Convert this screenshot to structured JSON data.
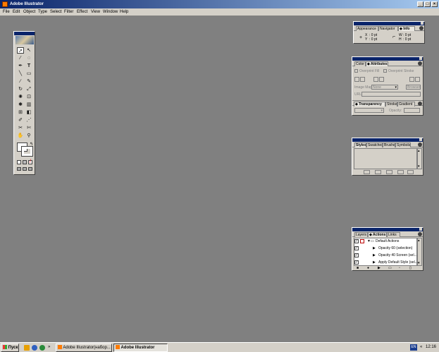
{
  "window": {
    "title": "Adobe Illustrator"
  },
  "window_buttons": {
    "minimize": "_",
    "maximize": "□",
    "close": "×"
  },
  "menubar": [
    "File",
    "Edit",
    "Object",
    "Type",
    "Select",
    "Filter",
    "Effect",
    "View",
    "Window",
    "Help"
  ],
  "info_panel": {
    "tabs": [
      "Appearance",
      "Navigator",
      "◆ Info"
    ],
    "x_label": "X",
    "x_value": ": 0 pt",
    "y_label": "Y",
    "y_value": ": 0 pt",
    "w_label": "W",
    "w_value": ": 0 pt",
    "h_label": "H",
    "h_value": ": 0 pt"
  },
  "attributes_panel": {
    "tabs": [
      "Color",
      "◆ Attributes"
    ],
    "overprint_fill": "Overprint Fill",
    "overprint_stroke": "Overprint Stroke",
    "image_map_label": "Image Map:",
    "image_map_value": "None",
    "browser_button": "Browser",
    "url_label": "URL:"
  },
  "transparency_panel": {
    "tabs": [
      "◆ Transparency",
      "Stroke",
      "Gradient"
    ],
    "opacity_label": "Opacity:"
  },
  "styles_panel": {
    "tabs": [
      "Styles",
      "Swatches",
      "Brushes",
      "Symbols"
    ]
  },
  "actions_panel": {
    "tabs": [
      "Layers",
      "◆ Actions",
      "Links"
    ],
    "rows": [
      {
        "label": "Default Actions",
        "type": "set"
      },
      {
        "label": "Opacity 60 (selection)",
        "type": "action"
      },
      {
        "label": "Opacity 40 Screen (sel...",
        "type": "action"
      },
      {
        "label": "Apply Default Style (sel...",
        "type": "action"
      }
    ]
  },
  "taskbar": {
    "start": "Пуск",
    "quicklaunch_more": "»",
    "tasks": [
      {
        "label": "Adobe Illustrator(набор...",
        "pressed": false
      },
      {
        "label": "Adobe Illustrator",
        "pressed": true
      }
    ],
    "lang": "EN",
    "tray_more": "«",
    "clock": "12:16"
  }
}
